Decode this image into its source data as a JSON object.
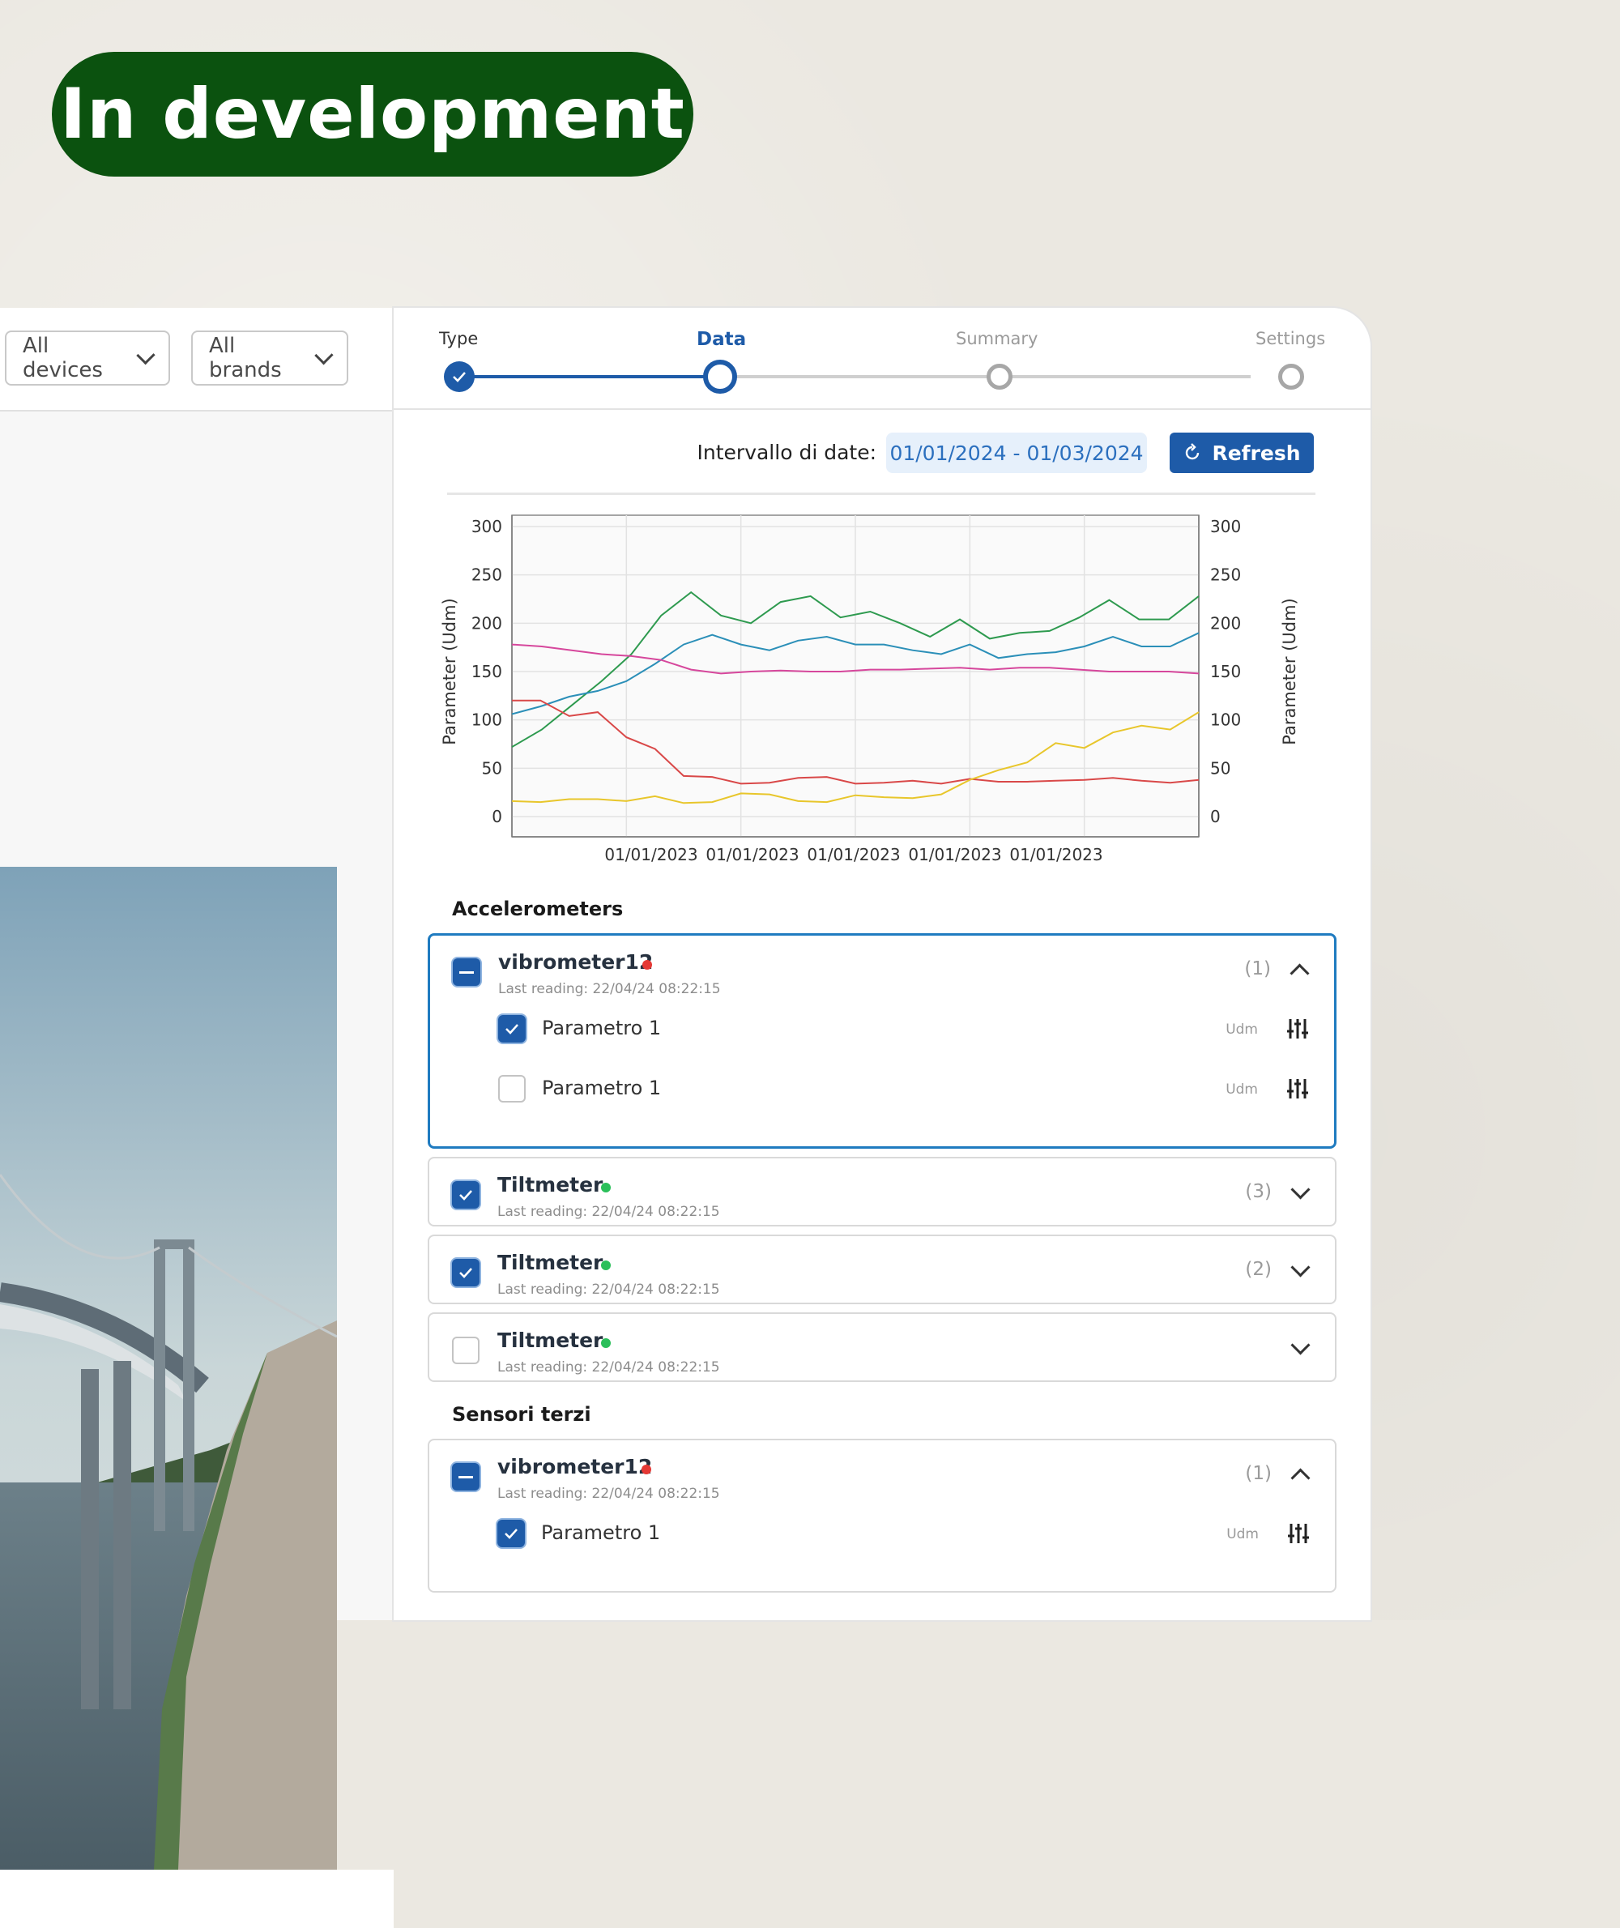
{
  "badge": {
    "label": "In development"
  },
  "filters": {
    "devices": "All devices",
    "brands": "All brands"
  },
  "stepper": {
    "steps": [
      {
        "label": "Type",
        "state": "done"
      },
      {
        "label": "Data",
        "state": "active"
      },
      {
        "label": "Summary",
        "state": "pending"
      },
      {
        "label": "Settings",
        "state": "pending"
      }
    ]
  },
  "date_range": {
    "label": "Intervallo di date:",
    "value": "01/01/2024 - 01/03/2024"
  },
  "refresh": {
    "label": "Refresh"
  },
  "chart_data": {
    "type": "line",
    "ylabel_left": "Parameter (Udm)",
    "ylabel_right": "Parameter (Udm)",
    "ylim": [
      0,
      300
    ],
    "y_ticks": [
      0,
      50,
      100,
      150,
      200,
      250,
      300
    ],
    "x_tick_labels": [
      "01/01/2023",
      "01/01/2023",
      "01/01/2023",
      "01/01/2023",
      "01/01/2023"
    ],
    "grid": true,
    "series": [
      {
        "color": "#2e9a4f",
        "values": [
          72,
          90,
          115,
          140,
          168,
          208,
          232,
          208,
          200,
          222,
          228,
          206,
          212,
          200,
          186,
          204,
          184,
          190,
          192,
          206,
          224,
          204,
          204,
          228
        ]
      },
      {
        "color": "#2b8fb8",
        "values": [
          106,
          114,
          124,
          130,
          140,
          158,
          178,
          188,
          178,
          172,
          182,
          186,
          178,
          178,
          172,
          168,
          178,
          164,
          168,
          170,
          176,
          186,
          176,
          176,
          190
        ]
      },
      {
        "color": "#d6479c",
        "values": [
          178,
          176,
          172,
          168,
          166,
          162,
          152,
          148,
          150,
          151,
          150,
          150,
          152,
          152,
          153,
          154,
          152,
          154,
          154,
          152,
          150,
          150,
          150,
          148
        ]
      },
      {
        "color": "#d94848",
        "values": [
          120,
          120,
          104,
          108,
          82,
          70,
          42,
          41,
          34,
          35,
          40,
          41,
          34,
          35,
          37,
          34,
          39,
          36,
          36,
          37,
          38,
          40,
          37,
          35,
          38
        ]
      },
      {
        "color": "#e8c62b",
        "values": [
          16,
          15,
          18,
          18,
          16,
          21,
          14,
          15,
          24,
          23,
          16,
          15,
          22,
          20,
          19,
          23,
          38,
          48,
          56,
          76,
          71,
          87,
          94,
          90,
          108
        ]
      }
    ]
  },
  "sections": [
    {
      "title": "Accelerometers",
      "devices": [
        {
          "name": "vibrometer12",
          "status_color": "#e53935",
          "sub": "Last reading: 22/04/24 08:22:15",
          "count": "(1)",
          "check": "ind",
          "open": true,
          "params": [
            {
              "name": "Parametro 1",
              "unit": "Udm",
              "checked": true
            },
            {
              "name": "Parametro 1",
              "unit": "Udm",
              "checked": false
            }
          ]
        },
        {
          "name": "Tiltmeter",
          "status_color": "#2bbf5a",
          "sub": "Last reading: 22/04/24 08:22:15",
          "count": "(3)",
          "check": "on",
          "open": false
        },
        {
          "name": "Tiltmeter",
          "status_color": "#2bbf5a",
          "sub": "Last reading: 22/04/24 08:22:15",
          "count": "(2)",
          "check": "on",
          "open": false
        },
        {
          "name": "Tiltmeter",
          "status_color": "#2bbf5a",
          "sub": "Last reading: 22/04/24 08:22:15",
          "count": "",
          "check": "off",
          "open": false
        }
      ]
    },
    {
      "title": "Sensori terzi",
      "devices": [
        {
          "name": "vibrometer12",
          "status_color": "#e53935",
          "sub": "Last reading: 22/04/24 08:22:15",
          "count": "(1)",
          "check": "ind",
          "open": true,
          "params": [
            {
              "name": "Parametro 1",
              "unit": "Udm",
              "checked": true
            }
          ]
        }
      ]
    }
  ],
  "icons": {
    "check": "check-icon",
    "refresh": "refresh-icon",
    "sliders": "sliders-icon",
    "chevron": "chevron-icon"
  }
}
